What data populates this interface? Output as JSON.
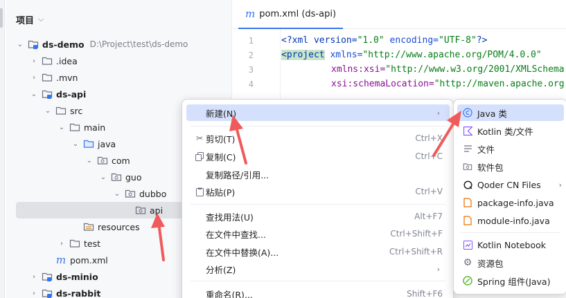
{
  "panel": {
    "title": "项目",
    "tree": [
      {
        "label": "ds-demo",
        "path": "D:\\Project\\test\\ds-demo"
      },
      {
        "label": ".idea"
      },
      {
        "label": ".mvn"
      },
      {
        "label": "ds-api"
      },
      {
        "label": "src"
      },
      {
        "label": "main"
      },
      {
        "label": "java"
      },
      {
        "label": "com"
      },
      {
        "label": "guo"
      },
      {
        "label": "dubbo"
      },
      {
        "label": "api"
      },
      {
        "label": "resources"
      },
      {
        "label": "test"
      },
      {
        "label": "pom.xml"
      },
      {
        "label": "ds-minio"
      },
      {
        "label": "ds-rabbit"
      }
    ]
  },
  "editor": {
    "tab_label": "pom.xml (ds-api)",
    "lines": [
      "1",
      "2",
      "3",
      "4"
    ],
    "code": {
      "l1_a": "<?xml version=",
      "l1_b": "\"1.0\"",
      "l1_c": " encoding=",
      "l1_d": "\"UTF-8\"",
      "l1_e": "?>",
      "l2_a": "<project",
      "l2_b": " xmlns=",
      "l2_c": "\"http://www.apache.org/POM/4.0.0\"",
      "l3_a": "xmlns:xsi=",
      "l3_b": "\"http://www.w3.org/2001/XMLSchema",
      "l4_a": "xsi:schemaLocation=",
      "l4_b": "\"http://maven.apache.org"
    }
  },
  "context_menu": {
    "items": [
      {
        "label": "新建(N)",
        "shortcut": ""
      },
      {
        "label": "剪切(T)",
        "shortcut": "Ctrl+X"
      },
      {
        "label": "复制(C)",
        "shortcut": "Ctrl+C"
      },
      {
        "label": "复制路径/引用...",
        "shortcut": ""
      },
      {
        "label": "粘贴(P)",
        "shortcut": "Ctrl+V"
      },
      {
        "label": "查找用法(U)",
        "shortcut": "Alt+F7"
      },
      {
        "label": "在文件中查找...",
        "shortcut": "Ctrl+Shift+F"
      },
      {
        "label": "在文件中替换(A)...",
        "shortcut": "Ctrl+Shift+R"
      },
      {
        "label": "分析(Z)",
        "shortcut": ""
      },
      {
        "label": "重命名(R)...",
        "shortcut": "Shift+F6"
      }
    ]
  },
  "submenu": {
    "items": [
      {
        "label": "Java 类"
      },
      {
        "label": "Kotlin 类/文件"
      },
      {
        "label": "文件"
      },
      {
        "label": "软件包"
      },
      {
        "label": "Qoder CN Files"
      },
      {
        "label": "package-info.java"
      },
      {
        "label": "module-info.java"
      },
      {
        "label": "Kotlin Notebook"
      },
      {
        "label": "资源包"
      },
      {
        "label": "Spring 组件(Java)"
      }
    ]
  },
  "colors": {
    "accent": "#3574f0",
    "selection": "#d5e1fc",
    "arrow": "#f05a5a",
    "java_icon": "#e76f00"
  }
}
